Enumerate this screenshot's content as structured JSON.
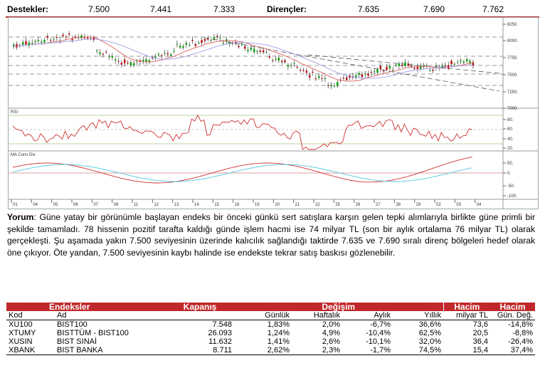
{
  "supports_label": "Destekler:",
  "supports": [
    "7.500",
    "7.441",
    "7.333"
  ],
  "resistances_label": "Dirençler:",
  "resistances": [
    "7.635",
    "7.690",
    "7.762"
  ],
  "chart": {
    "price_ticks": [
      "8250.",
      "8000.",
      "7750.",
      "7500.",
      "7250.",
      "7000."
    ],
    "rsi_title": "RSI",
    "rsi_ticks": [
      "80.",
      "60.",
      "40.",
      "20."
    ],
    "macd_title": "MA Conv Div",
    "macd_ticks": [
      "50.",
      "0.",
      "-50.",
      "-100."
    ],
    "dates": [
      "01",
      "04",
      "05",
      "06",
      "07",
      "08",
      "11",
      "12",
      "13",
      "14",
      "15",
      "18",
      "19",
      "20",
      "21",
      "22",
      "25",
      "26",
      "27",
      "28",
      "29",
      "02",
      "03",
      "04"
    ],
    "colors": {
      "up": "#00a000",
      "down": "#c00000",
      "ma": "#e07070",
      "signal": "#50c8e0",
      "trend": "#505050"
    }
  },
  "commentary": {
    "lead": "Yorum",
    "text": ": Güne yatay bir görünümle başlayan endeks bir önceki günkü sert satışlara karşın gelen tepki alımlarıyla birlikte güne primli bir şekilde tamamladı. 78 hissenin pozitif tarafta kaldığı günde işlem hacmi ise 74 milyar TL (son bir aylık ortalama 76 milyar TL) olarak gerçekleşti. Şu aşamada yakın 7.500 seviyesinin üzerinde kalıcılık sağlandığı taktirde 7.635 ve 7.690 sıralı direnç bölgeleri hedef olarak öne çıkıyor. Öte yandan, 7.500 seviyesinin kaybı halinde ise endekste tekrar satış baskısı gözlenebilir."
  },
  "table": {
    "group_headers": {
      "indices": "Endeksler",
      "close": "Kapanış",
      "change": "Değişim",
      "volume1": "Hacim",
      "volume2": "Hacim"
    },
    "columns": {
      "code": "Kod",
      "name": "Ad",
      "daily": "Günlük",
      "weekly": "Haftalık",
      "monthly": "Aylık",
      "yearly": "Yıllık",
      "vol": "milyar TL",
      "volchg": "Gün. Değ."
    },
    "rows": [
      {
        "code": "XU100",
        "name": "BIST100",
        "close": "7.548",
        "daily": "1,83%",
        "weekly": "2,0%",
        "monthly": "-6,7%",
        "yearly": "36,6%",
        "vol": "73,6",
        "volchg": "-14,8%"
      },
      {
        "code": "XTUMY",
        "name": "BISTTÜM - BIST100",
        "close": "26.093",
        "daily": "1,24%",
        "weekly": "4,9%",
        "monthly": "-10,4%",
        "yearly": "62,5%",
        "vol": "20,5",
        "volchg": "-8,8%"
      },
      {
        "code": "XUSIN",
        "name": "BIST SINAİ",
        "close": "11.632",
        "daily": "1,41%",
        "weekly": "2,6%",
        "monthly": "-10,1%",
        "yearly": "32,0%",
        "vol": "36,4",
        "volchg": "-26,4%"
      },
      {
        "code": "XBANK",
        "name": "BIST BANKA",
        "close": "8.711",
        "daily": "2,62%",
        "weekly": "2,3%",
        "monthly": "-1,7%",
        "yearly": "74,5%",
        "vol": "15,4",
        "volchg": "37,4%"
      }
    ]
  }
}
